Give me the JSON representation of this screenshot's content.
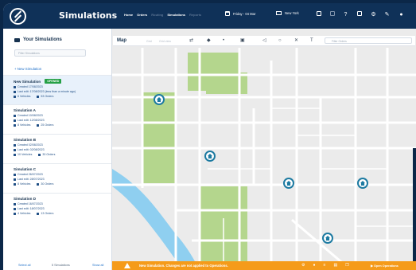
{
  "app": {
    "title": "Simulations"
  },
  "nav": {
    "items": [
      "Home",
      "Orders",
      "Routing",
      "Simulations",
      "Reports"
    ]
  },
  "header": {
    "date": "Friday - 04 Mar",
    "city": "New York"
  },
  "sidebar": {
    "title": "Your Simulations",
    "search_placeholder": "Filter Simulations",
    "new_label": "+ New Simulation",
    "simulations": [
      {
        "name": "New Simulation",
        "badge": "OPENED",
        "created": "Created 17/08/2023",
        "edited": "Last edit: 17/08/2023 (less than a minute ago)",
        "vehicles": "6 Vehicles",
        "orders": "53 Orders"
      },
      {
        "name": "Simulation A",
        "created": "Created 10/08/2023",
        "edited": "Last edit: 12/08/2023",
        "vehicles": "8 Vehicles",
        "orders": "25 Orders"
      },
      {
        "name": "Simulation B",
        "created": "Created 02/08/2023",
        "edited": "Last edit: 02/08/2023",
        "vehicles": "10 Vehicles",
        "orders": "30 Orders"
      },
      {
        "name": "Simulation C",
        "created": "Created 26/07/2023",
        "edited": "Last edit: 28/07/2023",
        "vehicles": "8 Vehicles",
        "orders": "30 Orders"
      },
      {
        "name": "Simulation D",
        "created": "Created 16/07/2023",
        "edited": "Last edit: 18/07/2023",
        "vehicles": "4 Vehicles",
        "orders": "13 Orders"
      }
    ],
    "footer": {
      "select_all": "Select all",
      "count": "5 Simulations",
      "show_all": "Show all"
    }
  },
  "map": {
    "label": "Map",
    "muted": [
      "Grid",
      "Grid view"
    ],
    "search_placeholder": "Filter Orders"
  },
  "bottom_bar": {
    "message": "New Simulation. Changes are not applied to Operations.",
    "operations_label": "Open Operations"
  },
  "colors": {
    "topbar": "#0f3158",
    "accent": "#1e6fc8",
    "warning": "#f59b1a",
    "opened": "#25a046",
    "park": "#b4d68d",
    "river": "#8fcff0"
  }
}
